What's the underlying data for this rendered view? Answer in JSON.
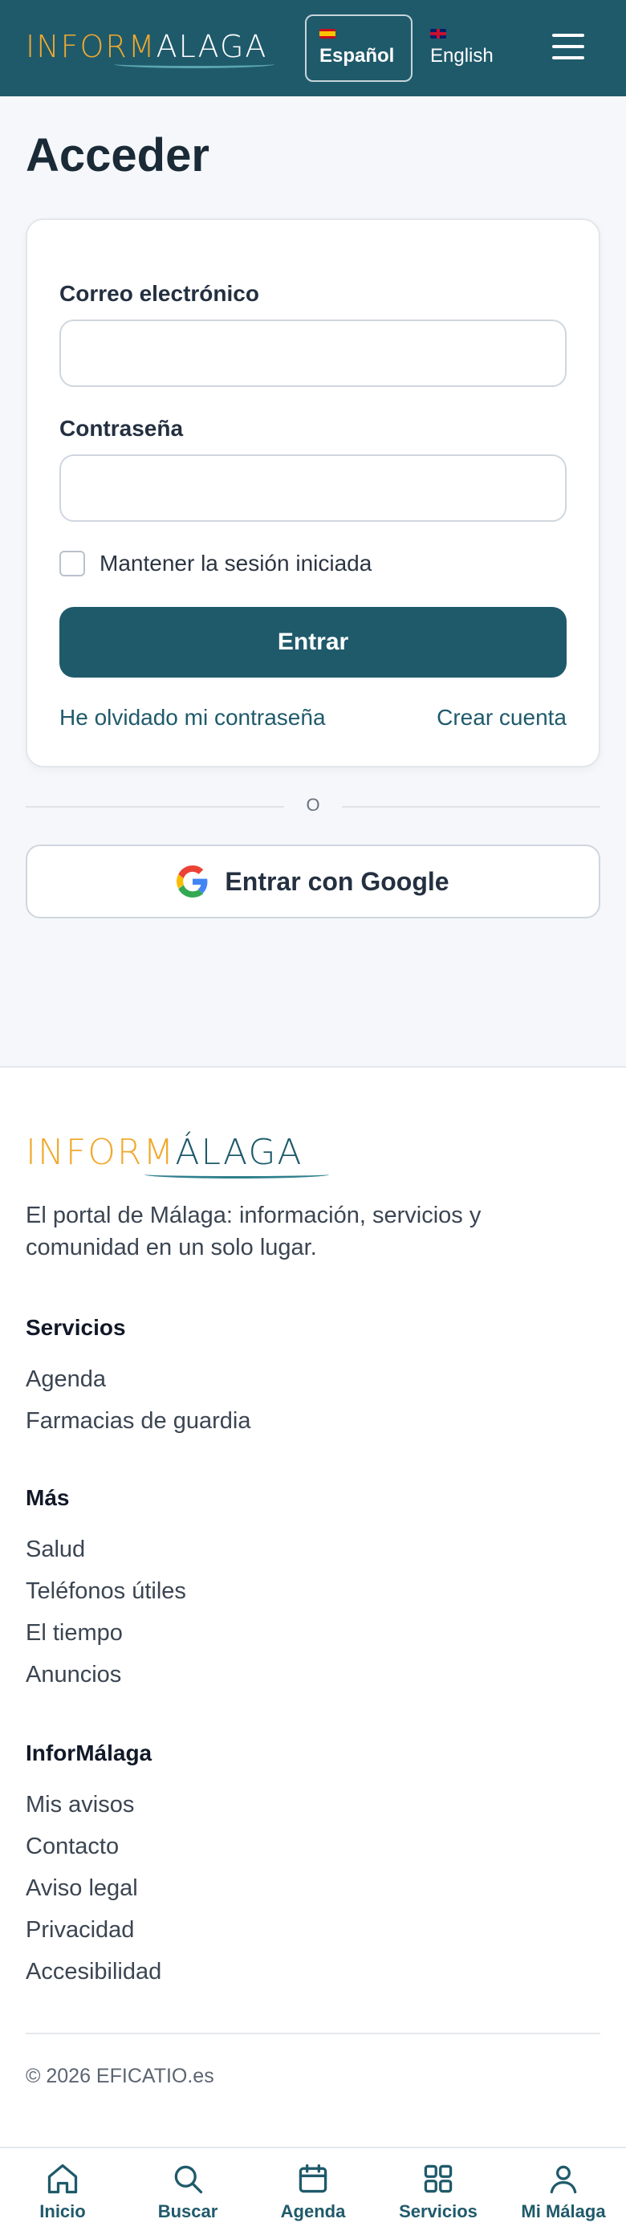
{
  "header": {
    "logo_part1": "INFORM",
    "logo_part2": "ALAGA",
    "languages": [
      {
        "label": "Español",
        "active": true
      },
      {
        "label": "English",
        "active": false
      }
    ]
  },
  "main": {
    "title": "Acceder",
    "form": {
      "email_label": "Correo electrónico",
      "email_value": "",
      "password_label": "Contraseña",
      "password_value": "",
      "remember_label": "Mantener la sesión iniciada",
      "remember_checked": false,
      "submit_label": "Entrar",
      "forgot_link": "He olvidado mi contraseña",
      "create_link": "Crear cuenta"
    },
    "divider_text": "O",
    "google_label": "Entrar con Google"
  },
  "footer": {
    "logo_part1": "INFORM",
    "logo_part2": "ÁLAGA",
    "description": "El portal de Málaga: información, servicios y comunidad en un solo lugar.",
    "sections": [
      {
        "heading": "Servicios",
        "items": [
          "Agenda",
          "Farmacias de guardia"
        ]
      },
      {
        "heading": "Más",
        "items": [
          "Salud",
          "Teléfonos útiles",
          "El tiempo",
          "Anuncios"
        ]
      },
      {
        "heading": "InforMálaga",
        "items": [
          "Mis avisos",
          "Contacto",
          "Aviso legal",
          "Privacidad",
          "Accesibilidad"
        ]
      }
    ],
    "copyright": "© 2026 EFICATIO.es"
  },
  "bottom_nav": {
    "items": [
      {
        "label": "Inicio",
        "icon": "home-icon"
      },
      {
        "label": "Buscar",
        "icon": "search-icon"
      },
      {
        "label": "Agenda",
        "icon": "calendar-icon"
      },
      {
        "label": "Servicios",
        "icon": "grid-icon"
      },
      {
        "label": "Mi Málaga",
        "icon": "user-icon"
      }
    ]
  },
  "colors": {
    "brand": "#1f5a6b",
    "accent": "#f0a92e"
  }
}
